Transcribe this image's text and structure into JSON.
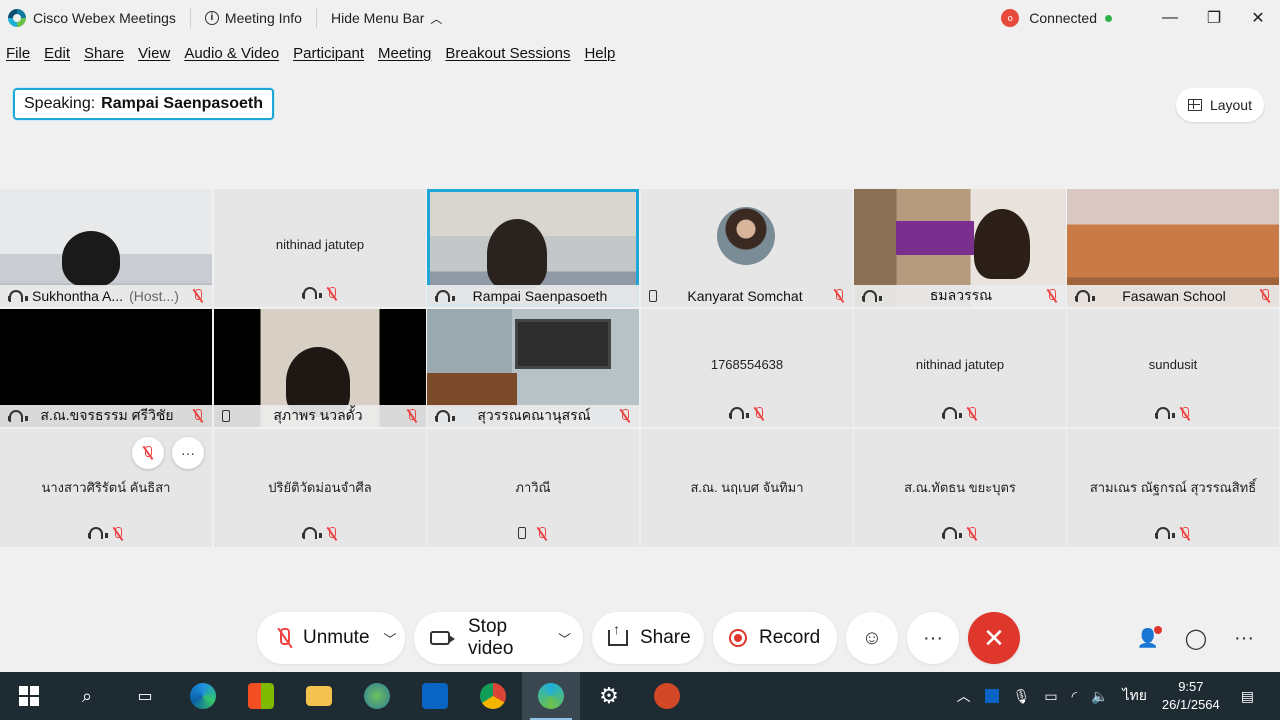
{
  "titlebar": {
    "app_name": "Cisco Webex Meetings",
    "meeting_info": "Meeting Info",
    "hide_menu_bar": "Hide Menu Bar",
    "connection_status": "Connected",
    "status_color": "#2bb34a"
  },
  "menu": [
    "File",
    "Edit",
    "Share",
    "View",
    "Audio & Video",
    "Participant",
    "Meeting",
    "Breakout Sessions",
    "Help"
  ],
  "speaking": {
    "label": "Speaking:",
    "name": "Rampai Saenpasoeth"
  },
  "layout_button": "Layout",
  "tiles": [
    {
      "name": "Sukhontha A...",
      "suffix": "(Host...)",
      "type": "video",
      "audio": "headset",
      "muted": true
    },
    {
      "name": "nithinad jatutep",
      "type": "blank",
      "audio": "headset",
      "muted": true
    },
    {
      "name": "Rampai Saenpasoeth",
      "type": "video",
      "audio": "headset",
      "muted": false,
      "active": true
    },
    {
      "name": "Kanyarat Somchat",
      "type": "avatar",
      "audio": "phone",
      "muted": true
    },
    {
      "name": "ธมลวรรณ",
      "type": "video",
      "audio": "headset",
      "muted": true
    },
    {
      "name": "Fasawan School",
      "type": "video",
      "audio": "headset",
      "muted": true
    },
    {
      "name": "ส.ณ.ขจรธรรม ศรีวิชัย",
      "type": "video",
      "audio": "headset",
      "muted": true
    },
    {
      "name": "สุภาพร นวลดั้ว",
      "type": "video",
      "audio": "phone",
      "muted": true
    },
    {
      "name": "สุวรรณคณานุสรณ์",
      "type": "video",
      "audio": "headset",
      "muted": true
    },
    {
      "name": "1768554638",
      "type": "blank",
      "audio": "headset",
      "muted": true
    },
    {
      "name": "nithinad jatutep",
      "type": "blank",
      "audio": "headset",
      "muted": true
    },
    {
      "name": "sundusit",
      "type": "blank",
      "audio": "headset",
      "muted": true
    },
    {
      "name": "นางสาวศิริรัตน์ คันธิสา",
      "type": "blank",
      "audio": "headset",
      "muted": true
    },
    {
      "name": "ปริยัติวัดม่อนจำศีล",
      "type": "blank",
      "audio": "headset",
      "muted": true
    },
    {
      "name": "ภาวิณี",
      "type": "blank",
      "audio": "phone",
      "muted": true
    },
    {
      "name": "ส.ณ. นฤเบศ จันทิมา",
      "type": "blank",
      "audio": "none",
      "muted": false
    },
    {
      "name": "ส.ณ.ทัตธน ขยะบุตร",
      "type": "blank",
      "audio": "headset",
      "muted": true
    },
    {
      "name": "สามเณร ณัฐกรณ์ สุวรรณสิทธิ์",
      "type": "blank",
      "audio": "headset",
      "muted": true
    }
  ],
  "controls": {
    "unmute": "Unmute",
    "stop_video": "Stop video",
    "share": "Share",
    "record": "Record",
    "end_color": "#e0372c"
  },
  "taskbar": {
    "language": "ไทย",
    "time": "9:57",
    "date": "26/1/2564"
  }
}
